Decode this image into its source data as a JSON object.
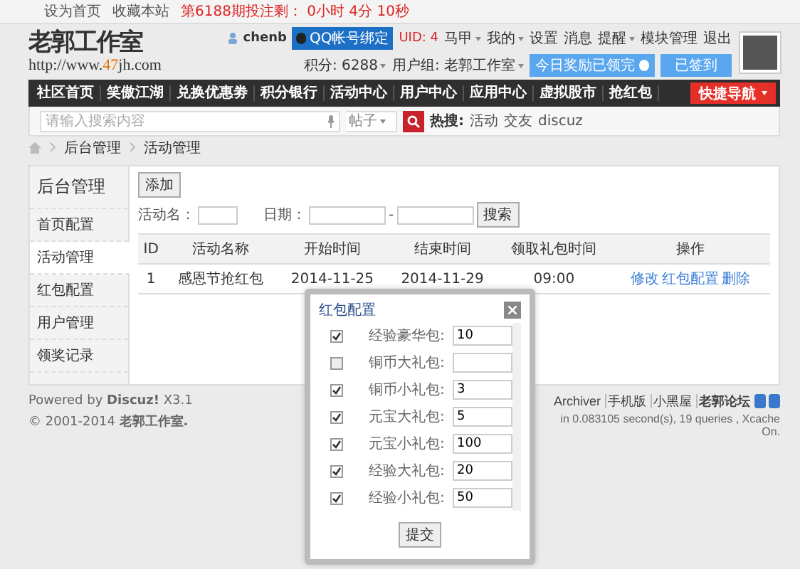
{
  "topbar": {
    "links": [
      "设为首页",
      "收藏本站"
    ],
    "notice": "第6188期投注剩： 0小时 4分 10秒"
  },
  "header": {
    "logo_title": "老郭工作室",
    "url_prefix": "http://www.",
    "url_accent": "47",
    "url_suffix": "jh.com",
    "username": "chenb",
    "qq_bind": "QQ帐号绑定",
    "uid": "UID: 4",
    "menu": [
      {
        "label": "马甲",
        "dropdown": true
      },
      {
        "label": "我的",
        "dropdown": true
      },
      {
        "label": "设置",
        "dropdown": false
      },
      {
        "label": "消息",
        "dropdown": false
      },
      {
        "label": "提醒",
        "dropdown": true
      },
      {
        "label": "模块管理",
        "dropdown": false
      },
      {
        "label": "退出",
        "dropdown": false
      }
    ],
    "credits": "积分: 6288",
    "group": "用户组: 老郭工作室",
    "reward_button": "今日奖励已领完",
    "signed_button": "已签到"
  },
  "nav": {
    "items": [
      "社区首页",
      "笑傲江湖",
      "兑换优惠劵",
      "积分银行",
      "活动中心",
      "用户中心",
      "应用中心",
      "虚拟股市",
      "抢红包"
    ],
    "quick": "快捷导航"
  },
  "search": {
    "placeholder": "请输入搜索内容",
    "type": "帖子",
    "hot_label": "热搜:",
    "hot": [
      "活动",
      "交友",
      "discuz"
    ]
  },
  "breadcrumb": [
    "后台管理",
    "活动管理"
  ],
  "sidebar": {
    "title": "后台管理",
    "items": [
      {
        "label": "首页配置",
        "selected": false
      },
      {
        "label": "活动管理",
        "selected": true
      },
      {
        "label": "红包配置",
        "selected": false
      },
      {
        "label": "用户管理",
        "selected": false
      },
      {
        "label": "领奖记录",
        "selected": false
      }
    ]
  },
  "content": {
    "add_button": "添加",
    "name_label": "活动名：",
    "date_label": "日期：",
    "date_dash": "-",
    "search_button": "搜索",
    "table": {
      "columns": [
        "ID",
        "活动名称",
        "开始时间",
        "结束时间",
        "领取礼包时间",
        "操作"
      ],
      "rows": [
        {
          "cells": [
            "1",
            "感恩节抢红包",
            "2014-11-25",
            "2014-11-29",
            "09:00"
          ],
          "actions": [
            "修改",
            "红包配置",
            "删除"
          ]
        }
      ]
    }
  },
  "footer": {
    "powered": "Powered by **Discuz!** X3.1",
    "copyright": "© 2001-2014 **老郭工作室.**",
    "links": [
      "Archiver",
      "手机版",
      "小黑屋",
      "老郭论坛"
    ],
    "stats": "in 0.083105 second(s), 19 queries , Xcache On."
  },
  "dialog": {
    "title": "红包配置",
    "rows": [
      {
        "checked": true,
        "label": "经验豪华包:",
        "value": "10"
      },
      {
        "checked": false,
        "label": "铜币大礼包:",
        "value": ""
      },
      {
        "checked": true,
        "label": "铜币小礼包:",
        "value": "3"
      },
      {
        "checked": true,
        "label": "元宝大礼包:",
        "value": "5"
      },
      {
        "checked": true,
        "label": "元宝小礼包:",
        "value": "100"
      },
      {
        "checked": true,
        "label": "经验大礼包:",
        "value": "20"
      },
      {
        "checked": true,
        "label": "经验小礼包:",
        "value": "50"
      }
    ],
    "submit": "提交"
  }
}
